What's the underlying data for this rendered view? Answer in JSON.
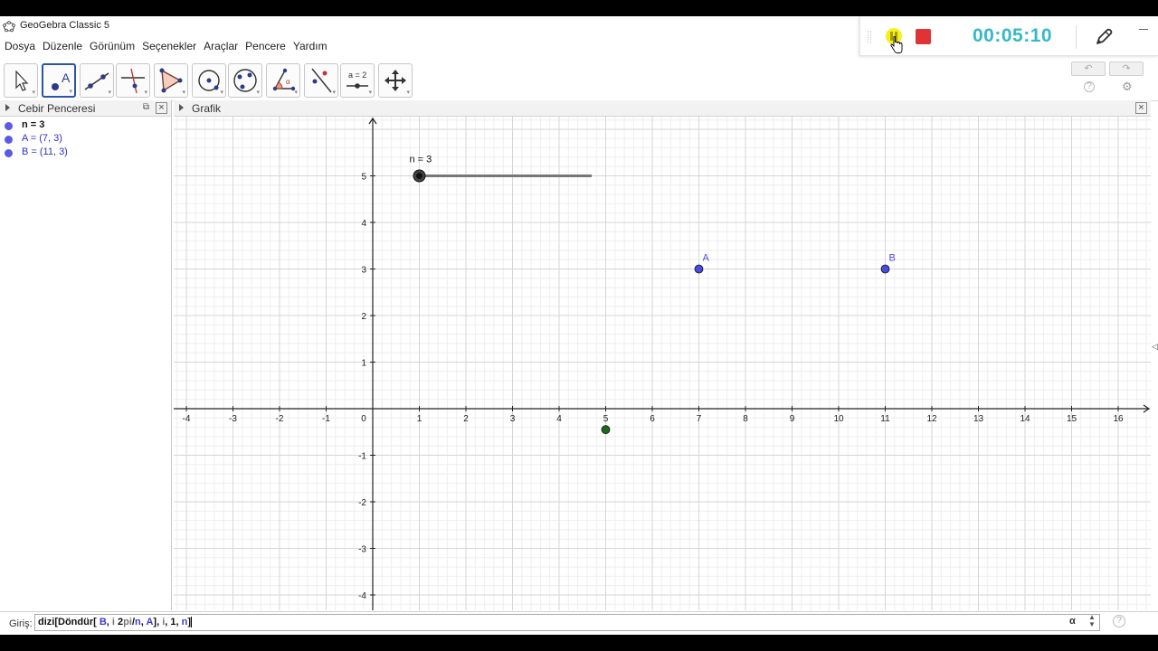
{
  "window": {
    "title": "GeoGebra Classic 5",
    "icon": "geogebra-logo-icon"
  },
  "menu": [
    "Dosya",
    "Düzenle",
    "Görünüm",
    "Seçenekler",
    "Araçlar",
    "Pencere",
    "Yardım"
  ],
  "recorder": {
    "time": "00:05:10",
    "pause_icon": "pause-icon",
    "stop_icon": "stop-icon",
    "pen_icon": "pen-icon",
    "minimize_icon": "minimize-icon",
    "pause_color": "#f6f01e",
    "stop_color": "#e03434",
    "time_color": "#35b9c9"
  },
  "toolbar": {
    "tools": [
      {
        "name": "move-tool",
        "icon": "arrow-pointer-icon"
      },
      {
        "name": "point-tool",
        "icon": "point-icon",
        "active": true
      },
      {
        "name": "line-tool",
        "icon": "line-icon"
      },
      {
        "name": "perpendicular-line-tool",
        "icon": "perpendicular-icon"
      },
      {
        "name": "polygon-tool",
        "icon": "polygon-icon"
      },
      {
        "name": "circle-tool",
        "icon": "circle-center-icon"
      },
      {
        "name": "ellipse-tool",
        "icon": "ellipse-icon"
      },
      {
        "name": "angle-tool",
        "icon": "angle-icon"
      },
      {
        "name": "reflect-tool",
        "icon": "reflect-icon"
      },
      {
        "name": "slider-tool",
        "icon": "slider-icon",
        "label": "a = 2"
      },
      {
        "name": "move-graphics-tool",
        "icon": "move-graphics-icon"
      }
    ],
    "undo": "↶",
    "redo": "↷",
    "help": "?",
    "settings": "⚙"
  },
  "algebra_view": {
    "title": "Cebir Penceresi",
    "close": "×",
    "undock": "⧉",
    "items": [
      {
        "text": "n = 3",
        "color": "#5a5ae6"
      },
      {
        "text": "A = (7, 3)",
        "color": "#5a5ae6"
      },
      {
        "text": "B = (11, 3)",
        "color": "#5a5ae6"
      }
    ]
  },
  "graphics_view": {
    "title": "Grafik",
    "close": "×",
    "x_ticks": [
      "-4",
      "-3",
      "-2",
      "-1",
      "0",
      "1",
      "2",
      "3",
      "4",
      "5",
      "6",
      "7",
      "8",
      "9",
      "10",
      "11",
      "12",
      "13",
      "14",
      "15",
      "16"
    ],
    "y_ticks": [
      "5",
      "4",
      "3",
      "2",
      "1",
      "-1",
      "-2",
      "-3",
      "-4"
    ],
    "points": [
      {
        "label": "A",
        "x": 7,
        "y": 3,
        "color": "#4a4ae0"
      },
      {
        "label": "B",
        "x": 11,
        "y": 3,
        "color": "#4a4ae0"
      },
      {
        "label": "",
        "x": 5,
        "y": -0.45,
        "color": "#1a6b1a"
      }
    ],
    "slider": {
      "label": "n = 3",
      "x_start": 1,
      "x_end": 4.7,
      "y": 5,
      "value_x": 1
    }
  },
  "input_bar": {
    "label": "Giriş:",
    "value_parts": [
      {
        "t": "dizi[Döndür[ ",
        "c": ""
      },
      {
        "t": "B",
        "c": "c-blue"
      },
      {
        "t": ", ",
        "c": ""
      },
      {
        "t": "i",
        "c": "c-grey"
      },
      {
        "t": " 2",
        "c": ""
      },
      {
        "t": "pi",
        "c": "c-grey"
      },
      {
        "t": "/",
        "c": ""
      },
      {
        "t": "n",
        "c": "c-blue"
      },
      {
        "t": ", ",
        "c": ""
      },
      {
        "t": "A",
        "c": "c-blue"
      },
      {
        "t": "], ",
        "c": ""
      },
      {
        "t": "i",
        "c": "c-grey"
      },
      {
        "t": ", 1, ",
        "c": ""
      },
      {
        "t": "n",
        "c": "c-blue"
      },
      {
        "t": "]",
        "c": ""
      }
    ],
    "alpha": "α",
    "help": "?"
  }
}
